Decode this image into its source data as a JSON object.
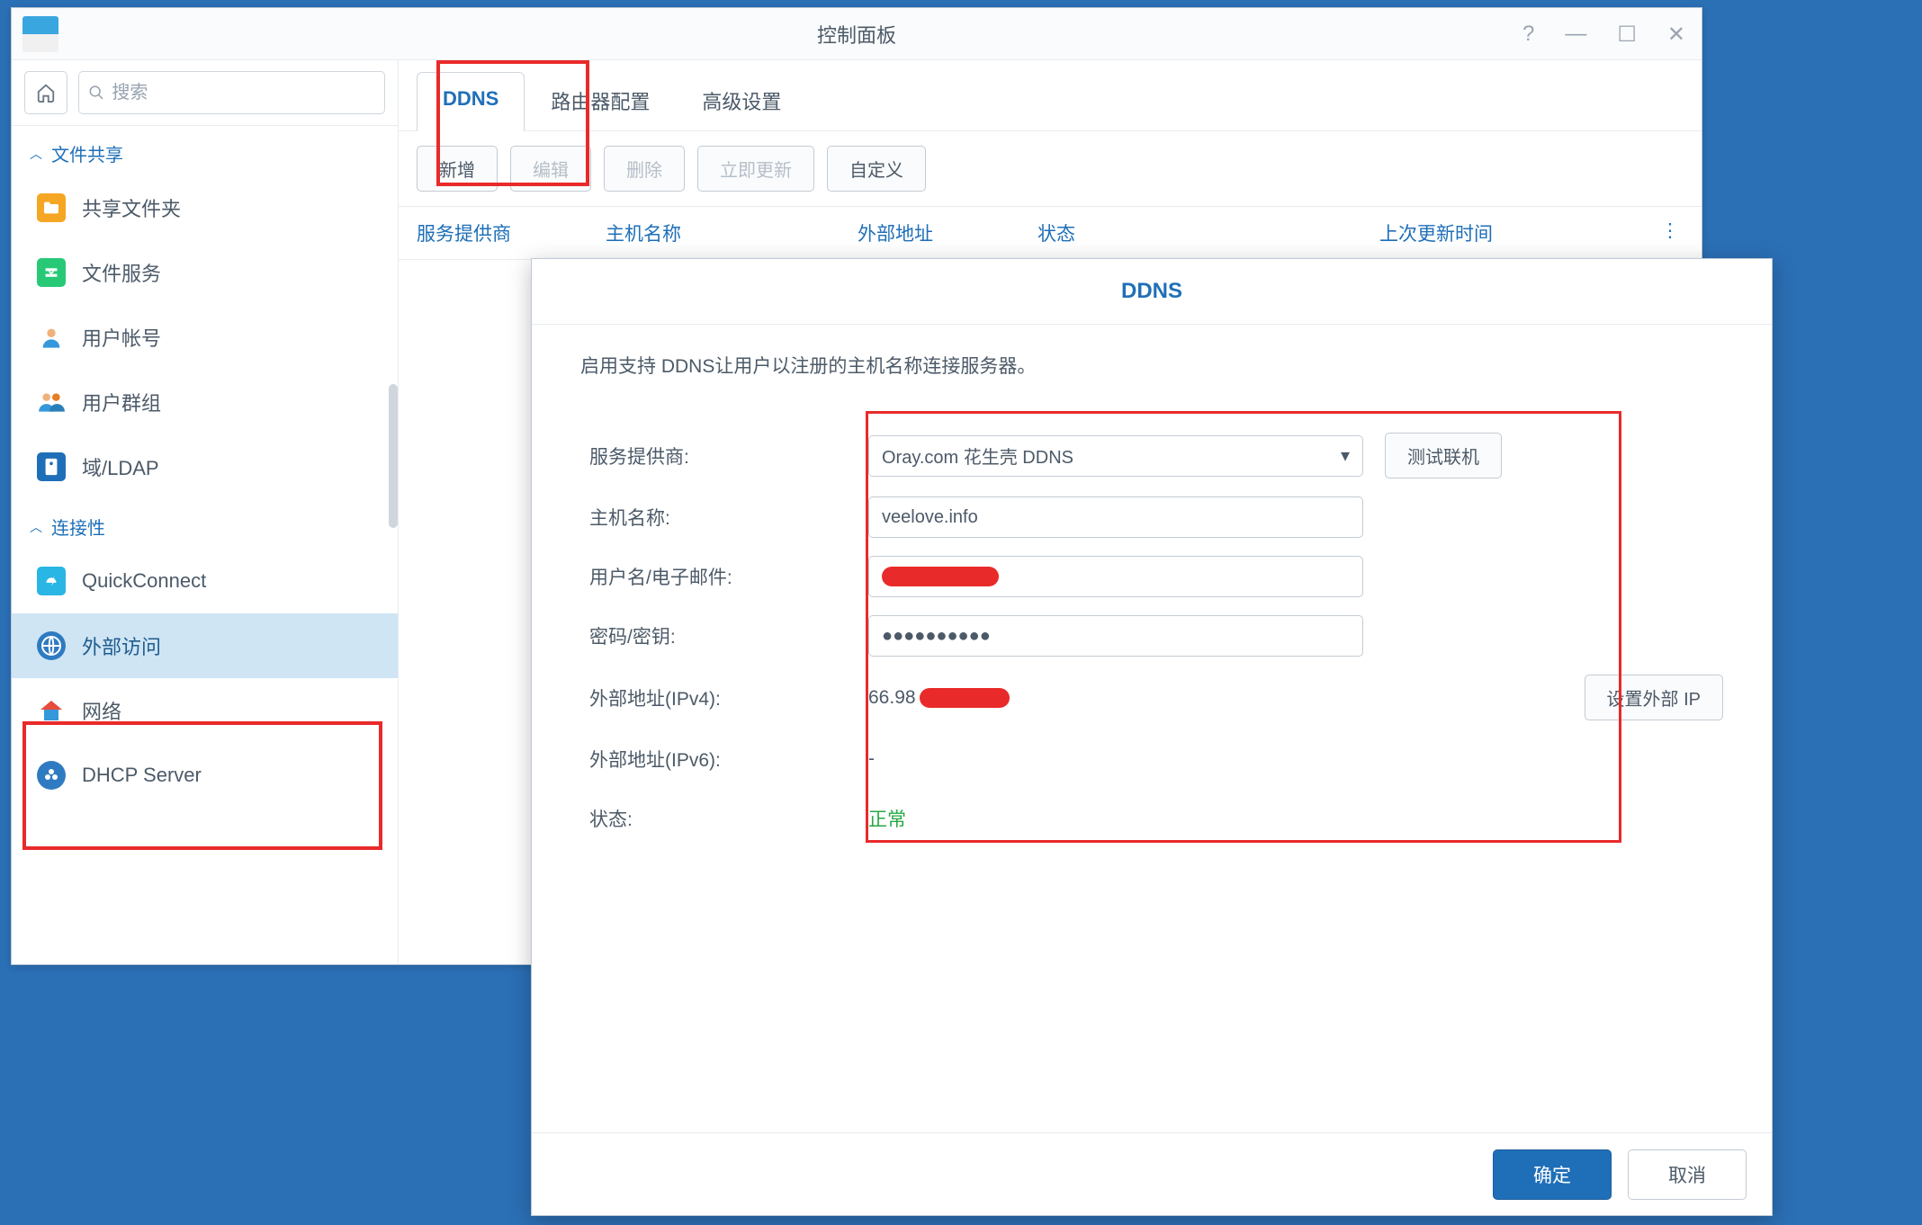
{
  "window": {
    "title": "控制面板",
    "controls": {
      "help": "?",
      "min": "—",
      "max": "☐",
      "close": "✕"
    }
  },
  "sidebar": {
    "search_placeholder": "搜索",
    "sections": {
      "file_sharing": "文件共享",
      "connectivity": "连接性"
    },
    "items": {
      "shared_folder": "共享文件夹",
      "file_services": "文件服务",
      "user": "用户帐号",
      "group": "用户群组",
      "domain": "域/LDAP",
      "quickconnect": "QuickConnect",
      "external_access": "外部访问",
      "network": "网络",
      "dhcp": "DHCP Server"
    }
  },
  "tabs": {
    "ddns": "DDNS",
    "router": "路由器配置",
    "advanced": "高级设置"
  },
  "toolbar": {
    "add": "新增",
    "edit": "编辑",
    "delete": "删除",
    "update_now": "立即更新",
    "custom": "自定义"
  },
  "table": {
    "provider": "服务提供商",
    "hostname": "主机名称",
    "external_addr": "外部地址",
    "status": "状态",
    "last_updated": "上次更新时间",
    "more": "⋮"
  },
  "modal": {
    "title": "DDNS",
    "desc": "启用支持 DDNS让用户以注册的主机名称连接服务器。",
    "labels": {
      "provider": "服务提供商:",
      "hostname": "主机名称:",
      "username": "用户名/电子邮件:",
      "password": "密码/密钥:",
      "ipv4": "外部地址(IPv4):",
      "ipv6": "外部地址(IPv6):",
      "status": "状态:"
    },
    "values": {
      "provider": "Oray.com 花生壳 DDNS",
      "hostname": "veelove.info",
      "password": "●●●●●●●●●●",
      "ipv4_prefix": "66.98",
      "ipv6": "-",
      "status": "正常"
    },
    "buttons": {
      "test": "测试联机",
      "set_ip": "设置外部 IP",
      "ok": "确定",
      "cancel": "取消"
    }
  }
}
